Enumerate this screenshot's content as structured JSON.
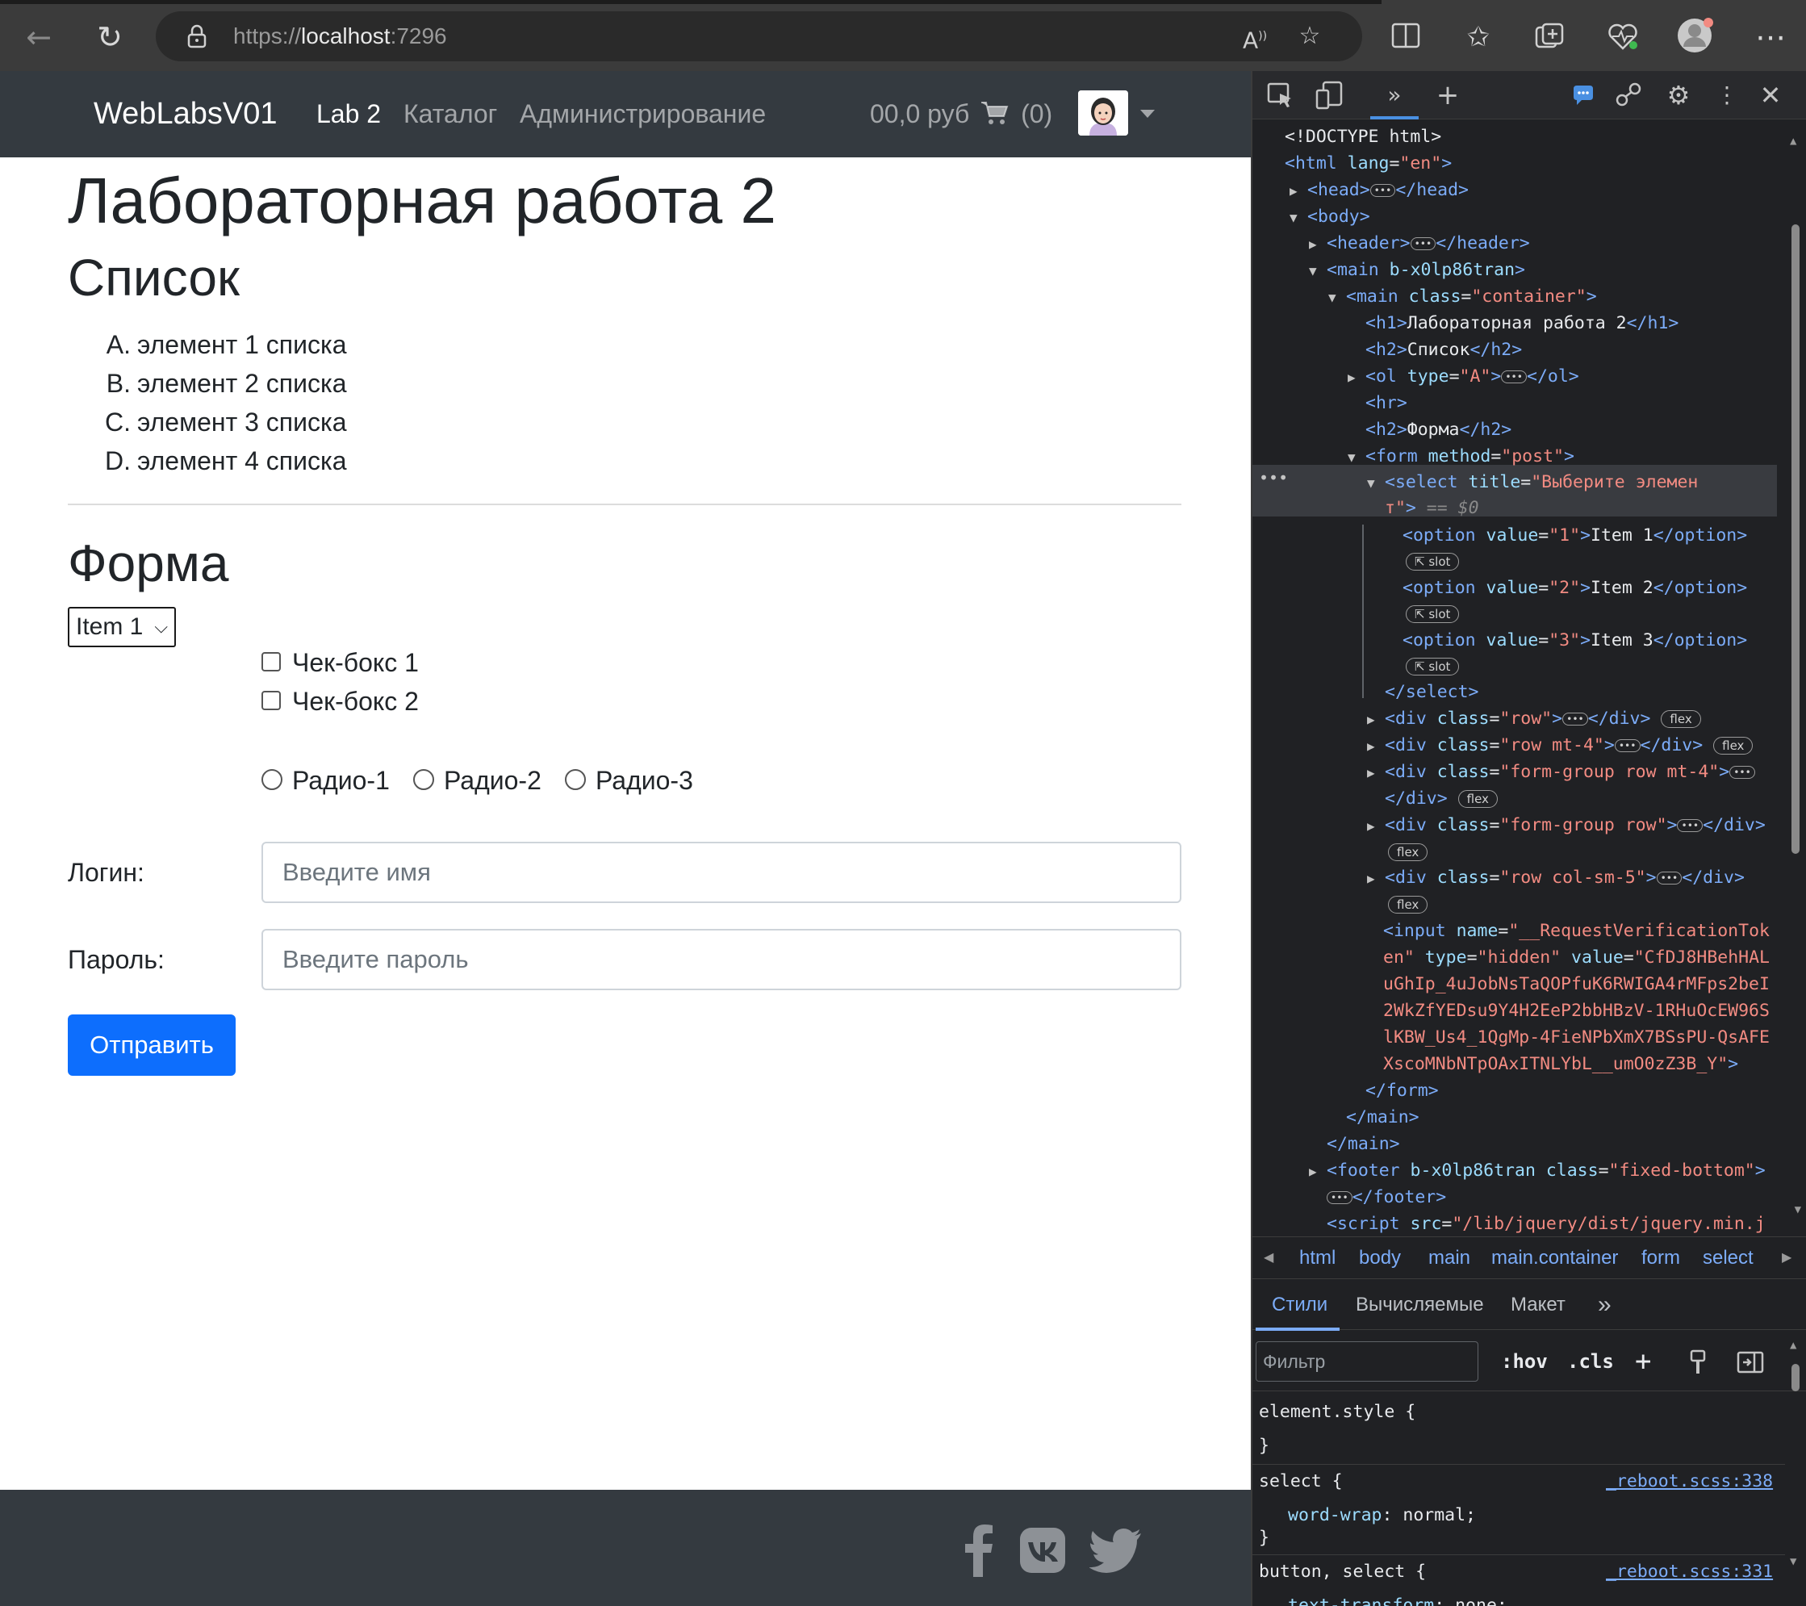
{
  "browser": {
    "url_host_prefix": "https://",
    "url_host": "localhost",
    "url_port": ":7296",
    "icons": [
      "back-arrow-icon",
      "refresh-icon",
      "lock-icon",
      "read-aloud-icon",
      "favorite-star-icon",
      "split-screen-icon",
      "favorites-icon",
      "collections-icon",
      "browser-health-icon",
      "profile-icon",
      "more-icon"
    ]
  },
  "navbar": {
    "brand": "WebLabsV01",
    "links": [
      {
        "label": "Lab 2",
        "active": true
      },
      {
        "label": "Каталог",
        "active": false
      },
      {
        "label": "Администрирование",
        "active": false
      }
    ],
    "cart_amount": "00,0 руб",
    "cart_count": "(0)"
  },
  "main": {
    "title": "Лабораторная работа 2",
    "list_title": "Список",
    "list_items": [
      {
        "marker": "A.",
        "text": "элемент 1 списка"
      },
      {
        "marker": "B.",
        "text": "элемент 2 списка"
      },
      {
        "marker": "C.",
        "text": "элемент 3 списка"
      },
      {
        "marker": "D.",
        "text": "элемент 4 списка"
      }
    ],
    "form_title": "Форма",
    "select_value": "Item 1",
    "checkboxes": [
      "Чек-бокс 1",
      "Чек-бокс 2"
    ],
    "radios": [
      "Радио-1",
      "Радио-2",
      "Радио-3"
    ],
    "login_label": "Логин:",
    "login_placeholder": "Введите имя",
    "password_label": "Пароль:",
    "password_placeholder": "Введите пароль",
    "submit_label": "Отправить"
  },
  "footer": {
    "icons": [
      "facebook-icon",
      "vk-icon",
      "twitter-icon"
    ]
  },
  "devtools": {
    "dom": {
      "l1": "<!DOCTYPE html>",
      "l2_tag": "<html",
      "l2_attr": " lang",
      "l2_val": "\"en\"",
      "l2_end": ">",
      "l3_open": "<head>",
      "l3_close": "</head>",
      "l4": "<body>",
      "l5_open": "<header>",
      "l5_close": "</header>",
      "l6_tag": "<main",
      "l6_attr": " b-x0lp86tran",
      "l6_end": ">",
      "l7_tag": "<main",
      "l7_attr": " class",
      "l7_val": "\"container\"",
      "l7_end": ">",
      "l8_open": "<h1>",
      "l8_text": "Лабораторная работа 2",
      "l8_close": "</h1>",
      "l9_open": "<h2>",
      "l9_text": "Список",
      "l9_close": "</h2>",
      "l10_tag": "<ol",
      "l10_attr": " type",
      "l10_val": "\"A\"",
      "l10_end": ">",
      "l10_close": "</ol>",
      "l11": "<hr>",
      "l12_open": "<h2>",
      "l12_text": "Форма",
      "l12_close": "</h2>",
      "l13_tag": "<form",
      "l13_attr": " method",
      "l13_val": "\"post\"",
      "l13_end": ">",
      "l14_tag": "<select",
      "l14_attr": " title",
      "l14_val": "\"Выберите элемен",
      "l15_val": "т\"",
      "l15_end": ">",
      "l15_eq": " == $0",
      "opt1_tag": "<option",
      "opt1_attr": " value",
      "opt1_val": "\"1\"",
      "opt1_text": "Item 1",
      "opt_close": "</option>",
      "opt2_val": "\"2\"",
      "opt2_text": "Item 2",
      "opt3_val": "\"3\"",
      "opt3_text": "Item 3",
      "slot": "slot",
      "select_close": "</select>",
      "div_tag": "<div",
      "class_attr": " class",
      "div1_val": "\"row\"",
      "div2_val": "\"row mt-4\"",
      "div3_val": "\"form-group row mt-4\"",
      "div4_val": "\"form-group row\"",
      "div5_val": "\"row col-sm-5\"",
      "div_close": "</div>",
      "flex": "flex",
      "input_tag": "<input",
      "input_name_attr": " name",
      "input_name_val": "\"__RequestVerificationTok",
      "input_line2_val": "en\"",
      "input_type_attr": " type",
      "input_type_val": "\"hidden\"",
      "input_value_attr": " value",
      "input_value_val1": "\"CfDJ8HBehHAL",
      "input_val2": "uGhIp_4uJobNsTaQOPfuK6RWIGA4rMFps2beI",
      "input_val3": "2WkZfYEDsu9Y4H2EeP2bbHBzV-1RHuOcEW96S",
      "input_val4": "lKBW_Us4_1QgMp-4FieNPbXmX7BSsPU-QsAFE",
      "input_val5": "XscoMNbNTpOAxITNLYbL__umO0zZ3B_Y\"",
      "form_close": "</form>",
      "main_close": "</main>",
      "footer_tag": "<footer",
      "footer_attr": " b-x0lp86tran class",
      "footer_val": "\"fixed-bottom\"",
      "footer_close": "</footer>",
      "script_tag": "<script",
      "script_attr": " src",
      "script_val": "\"/lib/jquery/dist/jquery.min.j"
    },
    "breadcrumbs": [
      "html",
      "body",
      "main",
      "main.container",
      "form",
      "select"
    ],
    "tabs": [
      "Стили",
      "Вычисляемые",
      "Макет"
    ],
    "filter_placeholder": "Фильтр",
    "hov": ":hov",
    "cls": ".cls",
    "styles": {
      "element_style": "element.style {",
      "close_brace": "}",
      "rule1_selector": "select {",
      "rule1_source": "_reboot.scss:338",
      "rule1_prop": "word-wrap",
      "rule1_value": ": normal;",
      "rule2_selector": "button, select {",
      "rule2_source": "_reboot.scss:331",
      "rule2_prop": "text-transform",
      "rule2_value": ": none;"
    }
  }
}
